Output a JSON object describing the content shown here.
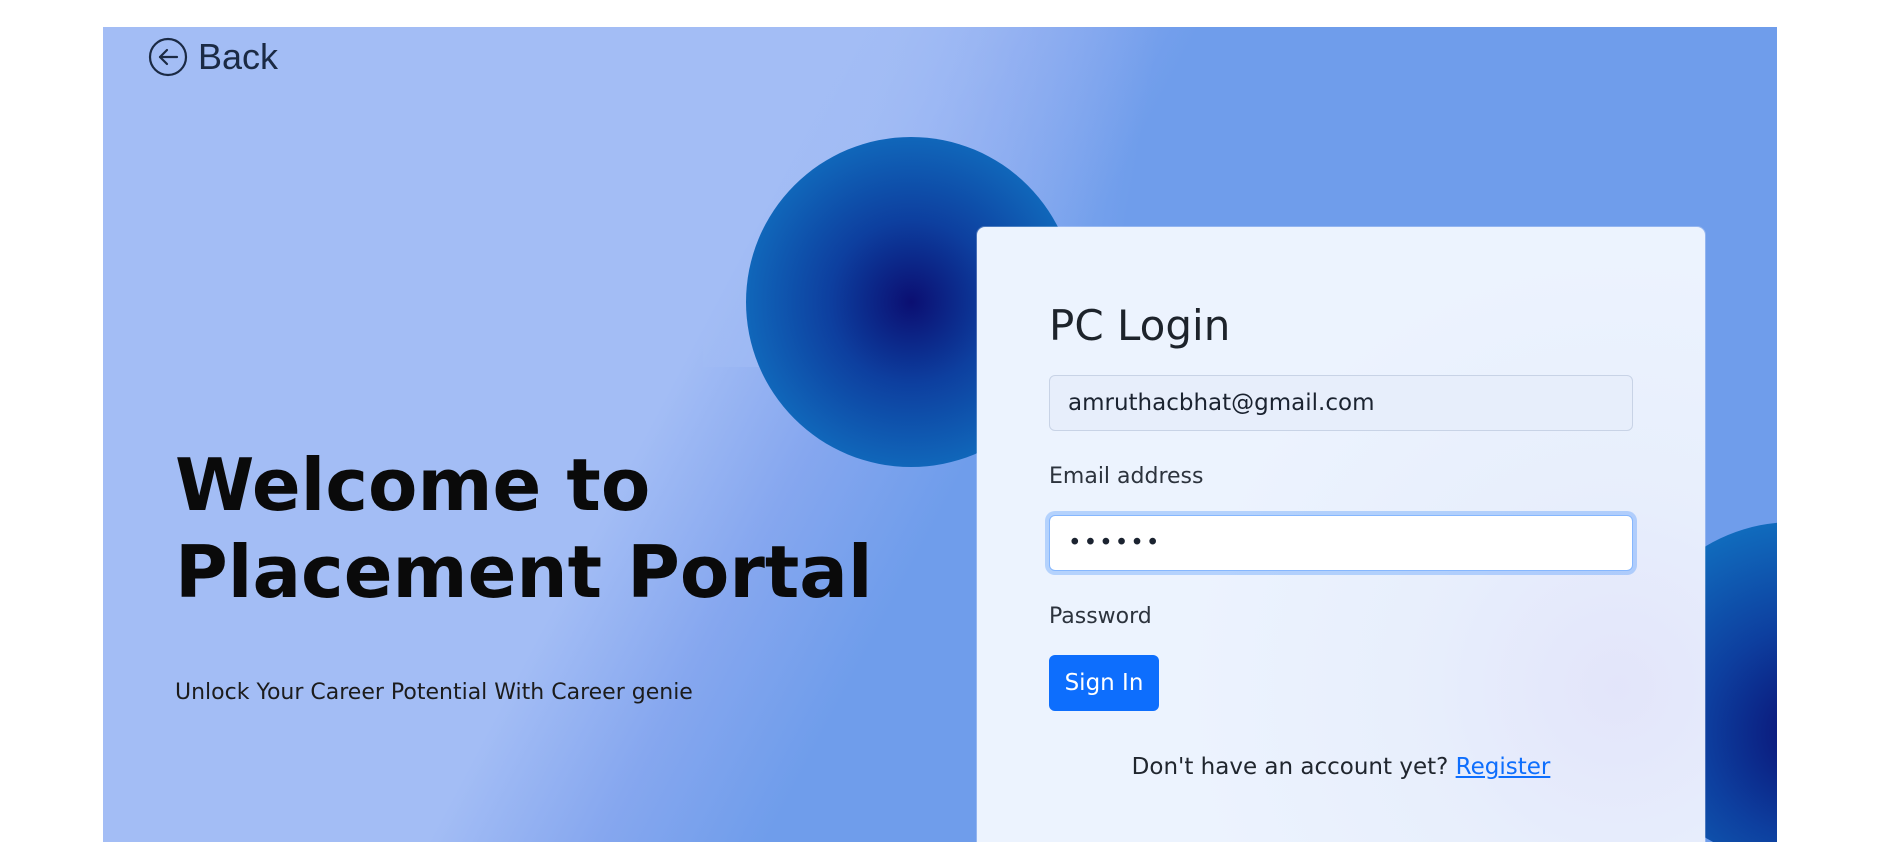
{
  "nav": {
    "back_label": "Back",
    "back_icon": "arrow-left-circle-icon"
  },
  "hero": {
    "title_line1": "Welcome to",
    "title_line2": "Placement Portal",
    "subtitle": "Unlock Your Career Potential With Career genie"
  },
  "login": {
    "title": "PC Login",
    "email_value": "amruthacbhat@gmail.com",
    "email_label": "Email address",
    "password_value": "••••••",
    "password_label": "Password",
    "signin_label": "Sign In",
    "register_prompt": "Don't have an account yet?",
    "register_link": "Register"
  },
  "colors": {
    "background_light": "#a3bdf5",
    "background_mid": "#6f9deb",
    "orb_center": "#0b0f72",
    "orb_edge": "#1387d0",
    "card_bg": "#ecf3fe",
    "primary_button": "#0d6efd",
    "link": "#0d6efd"
  }
}
